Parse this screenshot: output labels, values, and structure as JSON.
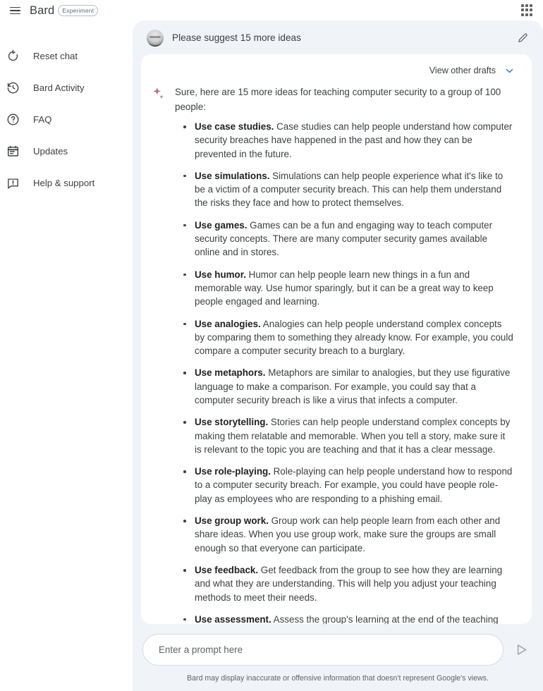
{
  "header": {
    "menu_icon": "hamburger-icon",
    "brand": "Bard",
    "badge": "Experiment",
    "apps_icon": "apps-grid-icon"
  },
  "sidebar": {
    "items": [
      {
        "icon": "reset-icon",
        "label": "Reset chat"
      },
      {
        "icon": "history-icon",
        "label": "Bard Activity"
      },
      {
        "icon": "help-icon",
        "label": "FAQ"
      },
      {
        "icon": "calendar-icon",
        "label": "Updates"
      },
      {
        "icon": "feedback-icon",
        "label": "Help & support"
      }
    ]
  },
  "conversation": {
    "user_prompt": "Please suggest 15 more ideas",
    "edit_icon": "pencil-icon",
    "avatar": "user-avatar",
    "drafts_label": "View other drafts",
    "drafts_chevron": "chevron-down-icon",
    "sparkle_icon": "sparkle-icon",
    "response_intro": "Sure, here are 15 more ideas for teaching computer security to a group of 100 people:",
    "ideas": [
      {
        "title": "Use case studies.",
        "text": " Case studies can help people understand how computer security breaches have happened in the past and how they can be prevented in the future."
      },
      {
        "title": "Use simulations.",
        "text": " Simulations can help people experience what it's like to be a victim of a computer security breach. This can help them understand the risks they face and how to protect themselves."
      },
      {
        "title": "Use games.",
        "text": " Games can be a fun and engaging way to teach computer security concepts. There are many computer security games available online and in stores."
      },
      {
        "title": "Use humor.",
        "text": " Humor can help people learn new things in a fun and memorable way. Use humor sparingly, but it can be a great way to keep people engaged and learning."
      },
      {
        "title": "Use analogies.",
        "text": " Analogies can help people understand complex concepts by comparing them to something they already know. For example, you could compare a computer security breach to a burglary."
      },
      {
        "title": "Use metaphors.",
        "text": " Metaphors are similar to analogies, but they use figurative language to make a comparison. For example, you could say that a computer security breach is like a virus that infects a computer."
      },
      {
        "title": "Use storytelling.",
        "text": " Stories can help people understand complex concepts by making them relatable and memorable. When you tell a story, make sure it is relevant to the topic you are teaching and that it has a clear message."
      },
      {
        "title": "Use role-playing.",
        "text": " Role-playing can help people understand how to respond to a computer security breach. For example, you could have people role-play as employees who are responding to a phishing email."
      },
      {
        "title": "Use group work.",
        "text": " Group work can help people learn from each other and share ideas. When you use group work, make sure the groups are small enough so that everyone can participate."
      },
      {
        "title": "Use feedback.",
        "text": " Get feedback from the group to see how they are learning and what they are understanding. This will help you adjust your teaching methods to meet their needs."
      },
      {
        "title": "Use assessment.",
        "text": " Assess the group's learning at the end of the teaching session to see how much they have learned. This will help you determine if"
      }
    ]
  },
  "composer": {
    "placeholder": "Enter a prompt here",
    "value": "",
    "send_icon": "send-icon",
    "disclaimer": "Bard may display inaccurate or offensive information that doesn't represent Google's views."
  },
  "colors": {
    "chat_background": "#f0f4f9",
    "card_background": "#ffffff",
    "accent_blue": "#1a73e8",
    "text_primary": "#3c4043",
    "badge_border": "#aebdd2"
  }
}
